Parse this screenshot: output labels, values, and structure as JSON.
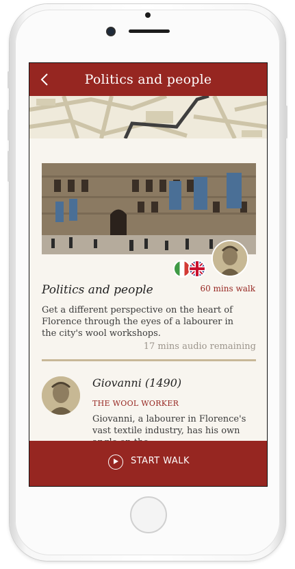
{
  "header": {
    "title": "Politics and people"
  },
  "walk": {
    "title": "Politics and people",
    "duration": "60 mins walk",
    "description": "Get a different perspective on the heart of Florence through the eyes of a labourer in the city's wool workshops.",
    "audio_remaining": "17 mins audio remaining"
  },
  "languages": [
    "Italian",
    "English"
  ],
  "character": {
    "name": "Giovanni (1490)",
    "role": "THE WOOL WORKER",
    "description": "Giovanni, a labourer in Florence's vast textile industry, has his own angle on the"
  },
  "cta": {
    "label": "START WALK"
  },
  "colors": {
    "brand": "#962621",
    "background": "#f8f5ef",
    "divider": "#c8b897"
  }
}
